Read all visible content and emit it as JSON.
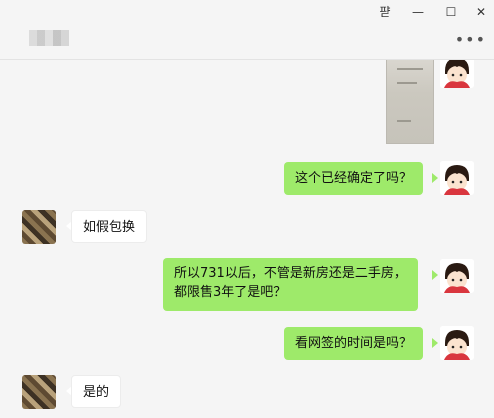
{
  "window": {
    "controls": {
      "pin": "퍋",
      "minimize": "—",
      "maximize": "☐",
      "close": "✕"
    },
    "more_label": "•••"
  },
  "colors": {
    "my_bubble": "#9eea6a",
    "other_bubble": "#ffffff",
    "background": "#f5f5f5"
  },
  "messages": [
    {
      "sender": "me",
      "type": "image"
    },
    {
      "sender": "me",
      "type": "text",
      "text": "这个已经确定了吗？"
    },
    {
      "sender": "other",
      "type": "text",
      "text": "如假包换"
    },
    {
      "sender": "me",
      "type": "text",
      "lines": [
        "所以731以后，不管是新房还是二手房，",
        "都限售3年了是吧？"
      ]
    },
    {
      "sender": "me",
      "type": "text",
      "text": "看网签的时间是吗？"
    },
    {
      "sender": "other",
      "type": "text",
      "text": "是的"
    }
  ]
}
